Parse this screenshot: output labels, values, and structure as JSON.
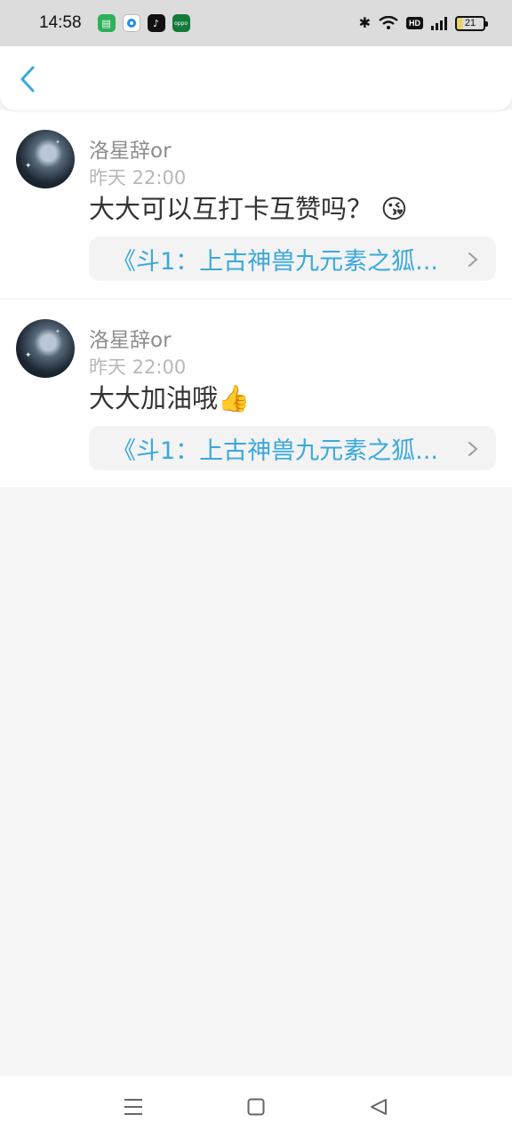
{
  "status_bar": {
    "time": "14:58",
    "app_icons": [
      "messages-icon",
      "browser-icon",
      "tiktok-icon",
      "oppo-icon"
    ],
    "battery_level": "21",
    "network": "4G"
  },
  "header": {
    "back_label": "<"
  },
  "comments": [
    {
      "username": "洛星辞or",
      "time": "昨天 22:00",
      "text": "大大可以互打卡互赞吗？",
      "emoji": "😘",
      "book_title": "《斗1：上古神兽九元素之狐..."
    },
    {
      "username": "洛星辞or",
      "time": "昨天 22:00",
      "text": "大大加油哦",
      "emoji": "👍",
      "book_title": "《斗1：上古神兽九元素之狐..."
    }
  ],
  "colors": {
    "accent": "#3aa8dd",
    "status_bar_bg": "#dcdcdc",
    "page_bg": "#f7f6f6"
  }
}
